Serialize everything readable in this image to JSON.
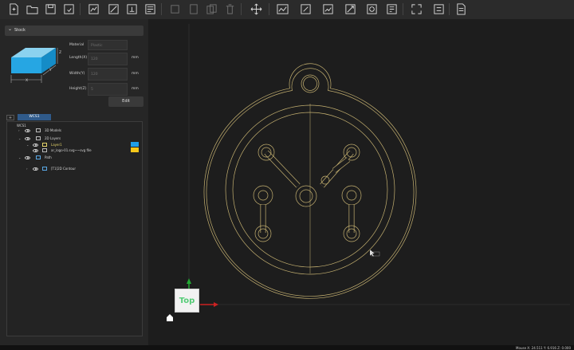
{
  "toolbar": {
    "groups": [
      [
        "new-file-icon",
        "open-folder-icon",
        "save-icon",
        "save-as-icon"
      ],
      [
        "import-icon",
        "export-icon",
        "export-2-icon",
        "export-3-icon"
      ],
      [
        "copy-icon",
        "paste-icon",
        "duplicate-icon",
        "delete-icon"
      ],
      [
        "transform-icon"
      ],
      [
        "view-2d-icon",
        "edit-toolpath-icon",
        "edit-2-icon",
        "edit-3-icon",
        "preview-icon",
        "simulate-icon"
      ],
      [
        "fit-view-icon",
        "export-gcode-icon"
      ],
      [
        "notes-icon"
      ]
    ],
    "disabled": [
      "copy-icon",
      "paste-icon",
      "duplicate-icon",
      "delete-icon"
    ]
  },
  "stock": {
    "header": "Stock",
    "axis_x": "X",
    "axis_y": "Y",
    "axis_z": "Z",
    "material_label": "Material",
    "material_value": "Plastic",
    "length_label": "Length(X)",
    "length_value": "120",
    "length_unit": "mm",
    "width_label": "Width(Y)",
    "width_value": "120",
    "width_unit": "mm",
    "height_label": "Height(Z)",
    "height_value": "5",
    "height_unit": "mm",
    "edit_label": "Edit"
  },
  "tree": {
    "tab_add": "+",
    "tab_active": "WCS1",
    "root": "WCS1",
    "models": "3D Models",
    "layers": "2D Layers",
    "layer1": "Layer1",
    "svg_file": "ar_logo-01.svg~~svg file",
    "path": "Path",
    "contour": "[T1]2D Contour"
  },
  "colors": {
    "accent_blue": "#1f9ee8",
    "accent_yellow": "#f5c71a",
    "outline": "#c4b070",
    "axis_green": "#22aa33",
    "axis_red": "#cc2222",
    "view_label": "#55cc77"
  },
  "viewport": {
    "view_label": "Top"
  },
  "status": {
    "coords": "Mouse X: 24.511 Y: 6.916 Z: 0.000"
  }
}
